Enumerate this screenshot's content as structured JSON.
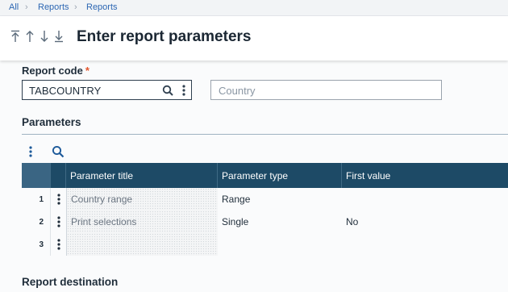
{
  "breadcrumb": [
    "All",
    "Reports",
    "Reports"
  ],
  "header": {
    "nav_icons": [
      "first-record-icon",
      "previous-record-icon",
      "next-record-icon",
      "last-record-icon"
    ],
    "title": "Enter report parameters"
  },
  "report_code": {
    "label": "Report code",
    "required_mark": "*",
    "value": "TABCOUNTRY",
    "description_placeholder": "Country"
  },
  "parameters": {
    "title": "Parameters",
    "columns": [
      "Parameter title",
      "Parameter type",
      "First value"
    ],
    "rows": [
      {
        "num": "1",
        "title": "Country range",
        "type": "Range",
        "first": ""
      },
      {
        "num": "2",
        "title": "Print selections",
        "type": "Single",
        "first": "No"
      },
      {
        "num": "3",
        "title": "",
        "type": "",
        "first": ""
      }
    ]
  },
  "destination": {
    "title": "Report destination"
  },
  "colors": {
    "accent": "#2d67b3",
    "table_header": "#1d4a66",
    "required": "#e4572e"
  }
}
